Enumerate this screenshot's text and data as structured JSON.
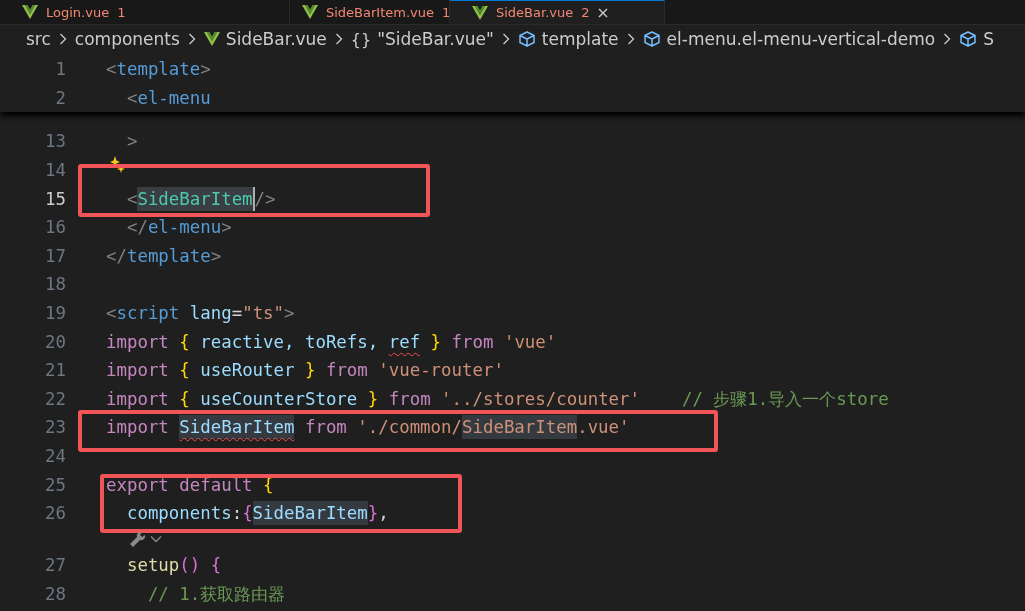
{
  "tabs": [
    {
      "label": "Login.vue",
      "count": "1",
      "selected": false
    },
    {
      "label": "SideBarItem.vue",
      "count": "1",
      "selected": false
    },
    {
      "label": "SideBar.vue",
      "count": "2",
      "selected": true
    }
  ],
  "breadcrumb": [
    {
      "kind": "folder",
      "label": "src"
    },
    {
      "kind": "folder",
      "label": "components"
    },
    {
      "kind": "vue",
      "label": "SideBar.vue"
    },
    {
      "kind": "object",
      "icon": "{}",
      "label": "\"SideBar.vue\""
    },
    {
      "kind": "element",
      "label": "template"
    },
    {
      "kind": "element",
      "label": "el-menu.el-menu-vertical-demo"
    },
    {
      "kind": "element",
      "label": "S"
    }
  ],
  "sticky_lines": [
    {
      "number": "1",
      "current": false,
      "tokens": [
        {
          "text": "<",
          "kind": "punct"
        },
        {
          "text": "template",
          "kind": "tag"
        },
        {
          "text": ">",
          "kind": "punct"
        }
      ]
    },
    {
      "number": "2",
      "current": false,
      "tokens": [
        {
          "text": "  <",
          "kind": "punct"
        },
        {
          "text": "el-menu",
          "kind": "tag"
        }
      ]
    }
  ],
  "blocks": [
    {
      "lines": [
        {
          "number": "13",
          "current": false,
          "tokens": [
            {
              "text": "  >",
              "kind": "punct"
            }
          ]
        }
      ]
    },
    {
      "boxed": true,
      "lines": [
        {
          "number": "14",
          "current": false,
          "kind": "sparkle"
        },
        {
          "number": "15",
          "current": true,
          "tokens": [
            {
              "text": "  <",
              "kind": "punct"
            },
            {
              "text": "SideBarItem",
              "kind": "component",
              "selected": true,
              "caret": true
            },
            {
              "text": "/>",
              "kind": "punct"
            }
          ]
        }
      ]
    },
    {
      "lines": [
        {
          "number": "16",
          "current": false,
          "tokens": [
            {
              "text": "  </",
              "kind": "punct"
            },
            {
              "text": "el-menu",
              "kind": "tag"
            },
            {
              "text": ">",
              "kind": "punct"
            }
          ]
        },
        {
          "number": "17",
          "current": false,
          "tokens": [
            {
              "text": "</",
              "kind": "punct"
            },
            {
              "text": "template",
              "kind": "tag"
            },
            {
              "text": ">",
              "kind": "punct"
            }
          ]
        },
        {
          "number": "18",
          "current": false
        },
        {
          "number": "19",
          "current": false,
          "tokens": [
            {
              "text": "<",
              "kind": "punct"
            },
            {
              "text": "script",
              "kind": "tag"
            },
            {
              "text": " lang",
              "kind": "attr"
            },
            {
              "text": "=",
              "kind": "plain"
            },
            {
              "text": "\"ts\"",
              "kind": "string"
            },
            {
              "text": ">",
              "kind": "punct"
            }
          ]
        },
        {
          "number": "20",
          "current": false,
          "tokens": [
            {
              "text": "import ",
              "kind": "keyword"
            },
            {
              "text": "{",
              "kind": "bracket1"
            },
            {
              "text": " reactive, toRefs, ",
              "kind": "var"
            },
            {
              "text": "ref",
              "kind": "var",
              "squiggle": true
            },
            {
              "text": " }",
              "kind": "bracket1"
            },
            {
              "text": " from ",
              "kind": "keyword"
            },
            {
              "text": "'vue'",
              "kind": "string"
            }
          ]
        },
        {
          "number": "21",
          "current": false,
          "tokens": [
            {
              "text": "import ",
              "kind": "keyword"
            },
            {
              "text": "{",
              "kind": "bracket1"
            },
            {
              "text": " useRouter ",
              "kind": "var"
            },
            {
              "text": "}",
              "kind": "bracket1"
            },
            {
              "text": " from ",
              "kind": "keyword"
            },
            {
              "text": "'vue-router'",
              "kind": "string"
            }
          ]
        },
        {
          "number": "22",
          "current": false,
          "tokens": [
            {
              "text": "import ",
              "kind": "keyword"
            },
            {
              "text": "{",
              "kind": "bracket1"
            },
            {
              "text": " useCounterStore ",
              "kind": "var"
            },
            {
              "text": "}",
              "kind": "bracket1"
            },
            {
              "text": " from ",
              "kind": "keyword"
            },
            {
              "text": "'../stores/counter'",
              "kind": "string"
            },
            {
              "text": "    // 步骤1.导入一个store",
              "kind": "comment"
            }
          ]
        }
      ]
    },
    {
      "boxed": true,
      "lines": [
        {
          "number": "23",
          "current": false,
          "tokens": [
            {
              "text": "import ",
              "kind": "keyword"
            },
            {
              "text": "SideBarItem",
              "kind": "var",
              "highlight": true,
              "squiggle": true
            },
            {
              "text": " from ",
              "kind": "keyword"
            },
            {
              "text": "'./common/",
              "kind": "string"
            },
            {
              "text": "SideBarItem",
              "kind": "string",
              "highlight": true
            },
            {
              "text": ".vue'",
              "kind": "string"
            }
          ]
        }
      ]
    },
    {
      "lines": [
        {
          "number": "24",
          "current": false
        }
      ]
    },
    {
      "boxed": true,
      "lines": [
        {
          "number": "25",
          "current": false,
          "tokens": [
            {
              "text": "export default ",
              "kind": "keyword"
            },
            {
              "text": "{",
              "kind": "bracket1"
            }
          ]
        },
        {
          "number": "26",
          "current": false,
          "tokens": [
            {
              "text": "  components",
              "kind": "var"
            },
            {
              "text": ":",
              "kind": "plain"
            },
            {
              "text": "{",
              "kind": "bracket2"
            },
            {
              "text": "SideBarItem",
              "kind": "var",
              "highlight": true
            },
            {
              "text": "}",
              "kind": "bracket2"
            },
            {
              "text": ",",
              "kind": "plain"
            }
          ]
        }
      ]
    },
    {
      "lines": [
        {
          "kind": "codelens"
        },
        {
          "number": "27",
          "current": false,
          "tokens": [
            {
              "text": "  setup",
              "kind": "func"
            },
            {
              "text": "()",
              "kind": "bracket2"
            },
            {
              "text": " {",
              "kind": "bracket2"
            }
          ]
        },
        {
          "number": "28",
          "current": false,
          "tokens": [
            {
              "text": "    // 1.获取路由器",
              "kind": "comment"
            }
          ]
        }
      ]
    }
  ]
}
